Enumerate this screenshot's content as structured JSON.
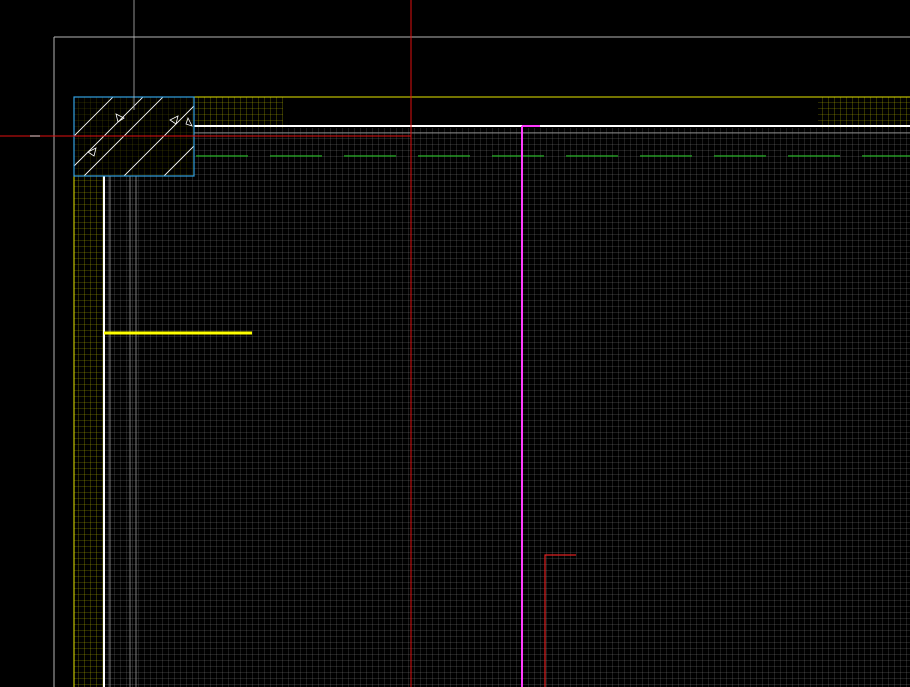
{
  "app": {
    "type": "cad-drawing-viewport"
  },
  "colors": {
    "background": "#000000",
    "outer_frame": "#b4b4b4",
    "grid_fine": "#7a7a7a",
    "grid_yellow": "#a8a800",
    "slab_edge_yellow": "#e6e600",
    "wall_white": "#ffffff",
    "column_cyan": "#33a0e0",
    "dashed_green": "#2db82d",
    "crosshair_red": "#e01010",
    "pipe_magenta": "#ff3cff",
    "detail_red": "#e02020",
    "yellow_bar": "#ffff00"
  },
  "drawing": {
    "column_annotations": [
      "A",
      "A",
      "A",
      "A"
    ],
    "dashed_line_style": "dashed",
    "cursor": "crosshair"
  }
}
